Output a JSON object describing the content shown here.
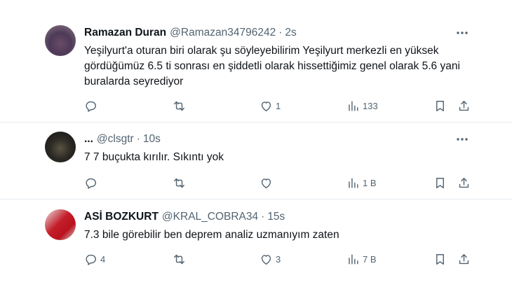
{
  "tweets": [
    {
      "name": "Ramazan Duran",
      "handle": "@Ramazan34796242",
      "separator": "·",
      "time": "2s",
      "text": "Yeşilyurt'a oturan biri olarak şu söyleyebilirim Yeşilyurt merkezli en yüksek gördüğümüz 6.5 ti sonrası en şiddetli olarak hissettiğimiz genel olarak 5.6 yani buralarda seyrediyor",
      "reply_count": "",
      "retweet_count": "",
      "like_count": "1",
      "view_count": "133"
    },
    {
      "name": "...",
      "handle": "@clsgtr",
      "separator": "·",
      "time": "10s",
      "text": "7 7 buçukta kırılır. Sıkıntı yok",
      "reply_count": "",
      "retweet_count": "",
      "like_count": "",
      "view_count": "1 B"
    },
    {
      "name": "ASİ BOZKURT",
      "handle": "@KRAL_COBRA34",
      "separator": "·",
      "time": "15s",
      "text": "7.3 bile görebilir ben deprem analiz uzmanıyım zaten",
      "reply_count": "4",
      "retweet_count": "",
      "like_count": "3",
      "view_count": "7 B"
    }
  ],
  "icons": {
    "more": "more-horizontal-icon",
    "reply": "reply-icon",
    "retweet": "retweet-icon",
    "like": "heart-icon",
    "views": "views-icon",
    "bookmark": "bookmark-icon",
    "share": "share-icon"
  },
  "colors": {
    "text": "#0f1419",
    "secondary": "#536471",
    "divider": "#e6ecf0"
  }
}
